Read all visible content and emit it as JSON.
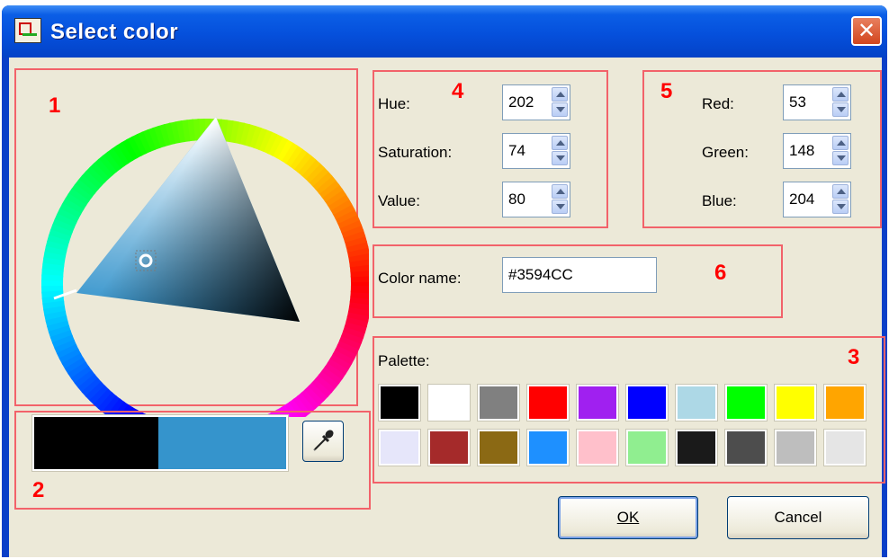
{
  "window": {
    "title": "Select color",
    "close_glyph": "✕"
  },
  "annotations": [
    "1",
    "2",
    "3",
    "4",
    "5",
    "6"
  ],
  "hsv": {
    "hue_label": "Hue:",
    "hue_value": "202",
    "saturation_label": "Saturation:",
    "saturation_value": "74",
    "value_label": "Value:",
    "value_value": "80"
  },
  "rgb": {
    "red_label": "Red:",
    "red_value": "53",
    "green_label": "Green:",
    "green_value": "148",
    "blue_label": "Blue:",
    "blue_value": "204"
  },
  "color_name": {
    "label": "Color name:",
    "value": "#3594CC"
  },
  "palette": {
    "label": "Palette:",
    "colors": [
      "#000000",
      "#ffffff",
      "#808080",
      "#ff0000",
      "#a020f0",
      "#0000ff",
      "#add8e6",
      "#00ff00",
      "#ffff00",
      "#ffa500",
      "#e6e6fa",
      "#a52a2a",
      "#8b6914",
      "#1e90ff",
      "#ffc0cb",
      "#90ee90",
      "#1a1a1a",
      "#4d4d4d",
      "#bebebe",
      "#e5e5e5"
    ]
  },
  "preview": {
    "old_color": "#000000",
    "new_color": "#3594CC"
  },
  "selected_color": "#3594CC",
  "buttons": {
    "ok": "OK",
    "cancel": "Cancel"
  },
  "icons": {
    "eyedropper": "eyedropper-icon",
    "app": "app-icon",
    "close": "close-icon"
  }
}
